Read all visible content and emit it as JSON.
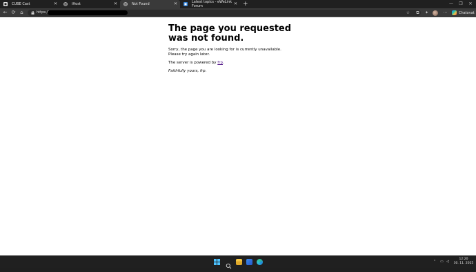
{
  "browser": {
    "tabs": [
      {
        "label": "CUBE Cast",
        "icon": "app-square-icon",
        "active": false
      },
      {
        "label": "iHost",
        "icon": "globe-icon",
        "active": false
      },
      {
        "label": "Not Found",
        "icon": "globe-icon",
        "active": true
      },
      {
        "label": "Latest topics - eWeLink Forum",
        "icon": "forum-icon",
        "active": false
      }
    ],
    "new_tab_symbol": "+",
    "address": {
      "prefix": "https://"
    },
    "copilot_label": "Chatovat"
  },
  "page": {
    "title": "The page you requested was not found.",
    "line1": "Sorry, the page you are looking for is currently unavailable.",
    "line2": "Please try again later.",
    "powered_prefix": "The server is powered by ",
    "powered_link": "frp",
    "powered_suffix": ".",
    "signature": "Faithfully yours, frp."
  },
  "taskbar": {
    "time": "12:20",
    "date": "30. 11. 2025"
  },
  "colors": {
    "accent": "#4cc2ff",
    "link_visited": "#551a8b",
    "chrome_dark": "#202020",
    "toolbar": "#3a3a3a"
  }
}
